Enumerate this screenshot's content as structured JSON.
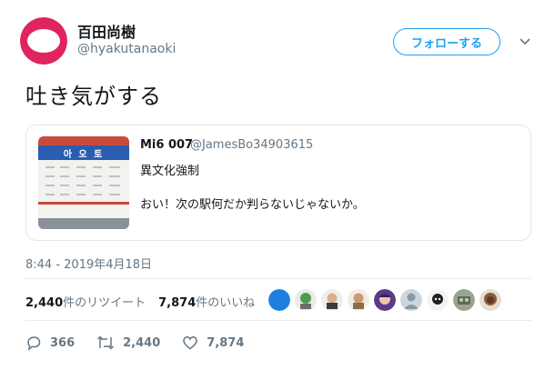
{
  "author": {
    "name": "百田尚樹",
    "handle": "@hyakutanaoki"
  },
  "follow_label": "フォローする",
  "tweet_text": "吐き気がする",
  "quote": {
    "name": "Mi6 007",
    "handle": "@JamesBo34903615",
    "line1": "異文化強制",
    "line2": "おい！次の駅何だか判らないじゃないか。",
    "image_sign_text": "아 오 토"
  },
  "timestamp": "8:44 - 2019年4月18日",
  "stats": {
    "retweets_count": "2,440",
    "retweets_label": "件のリツイート",
    "likes_count": "7,874",
    "likes_label": "件のいいね"
  },
  "actions": {
    "replies": "366",
    "retweets": "2,440",
    "likes": "7,874"
  },
  "colors": {
    "accent": "#1da1f2",
    "logo": "#e0245e",
    "muted": "#657786",
    "border": "#e1e8ed"
  }
}
